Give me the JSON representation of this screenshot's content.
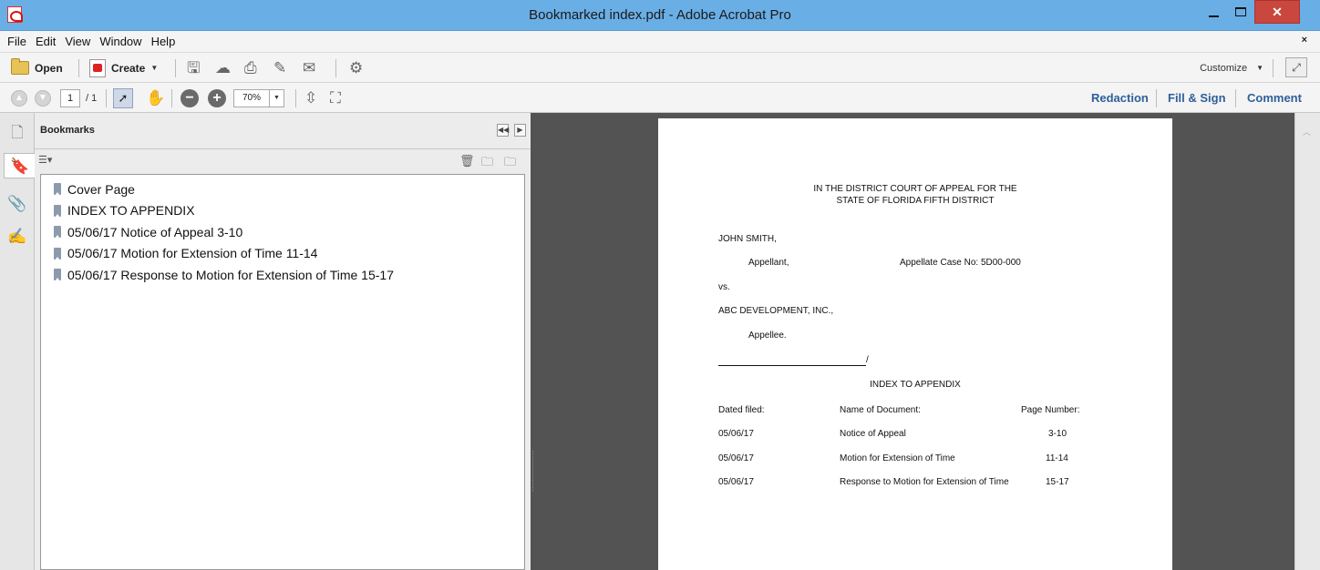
{
  "window": {
    "title": "Bookmarked index.pdf - Adobe Acrobat Pro",
    "controls": {
      "minimize": "minimize",
      "maximize": "maximize",
      "close": "✕"
    }
  },
  "menu": {
    "items": [
      "File",
      "Edit",
      "View",
      "Window",
      "Help"
    ],
    "close": "×"
  },
  "toolbar": {
    "open_label": "Open",
    "create_label": "Create",
    "customize_label": "Customize"
  },
  "nav": {
    "page_number": "1",
    "page_total": "/ 1",
    "zoom": "70%"
  },
  "panels": {
    "redaction": "Redaction",
    "fill_sign": "Fill & Sign",
    "comment": "Comment"
  },
  "bookmarks": {
    "title": "Bookmarks",
    "items": [
      "Cover Page",
      "INDEX TO APPENDIX",
      "05/06/17 Notice of Appeal 3-10",
      "05/06/17 Motion for Extension of Time 11-14",
      "05/06/17 Response to Motion for Extension of Time 15-17"
    ]
  },
  "document": {
    "court_line1": "IN THE DISTRICT COURT OF APPEAL FOR THE",
    "court_line2": "STATE OF FLORIDA FIFTH DISTRICT",
    "appellant_name": "JOHN SMITH,",
    "appellant_role": "Appellant,",
    "case_no": "Appellate Case No: 5D00-000",
    "vs": "vs.",
    "appellee_name": "ABC DEVELOPMENT, INC.,",
    "appellee_role": "Appellee.",
    "slash": "/",
    "index_title": "INDEX TO APPENDIX",
    "table": {
      "headers": [
        "Dated filed:",
        "Name of Document:",
        "Page Number:"
      ],
      "rows": [
        [
          "05/06/17",
          "Notice of Appeal",
          "3-10"
        ],
        [
          "05/06/17",
          "Motion for Extension of Time",
          "11-14"
        ],
        [
          "05/06/17",
          "Response to Motion for Extension of Time",
          "15-17"
        ]
      ]
    }
  },
  "colors": {
    "titlebar": "#6aaee6",
    "close_button": "#c9473d",
    "document_background": "#535353",
    "panel_link": "#2f5f9a"
  }
}
